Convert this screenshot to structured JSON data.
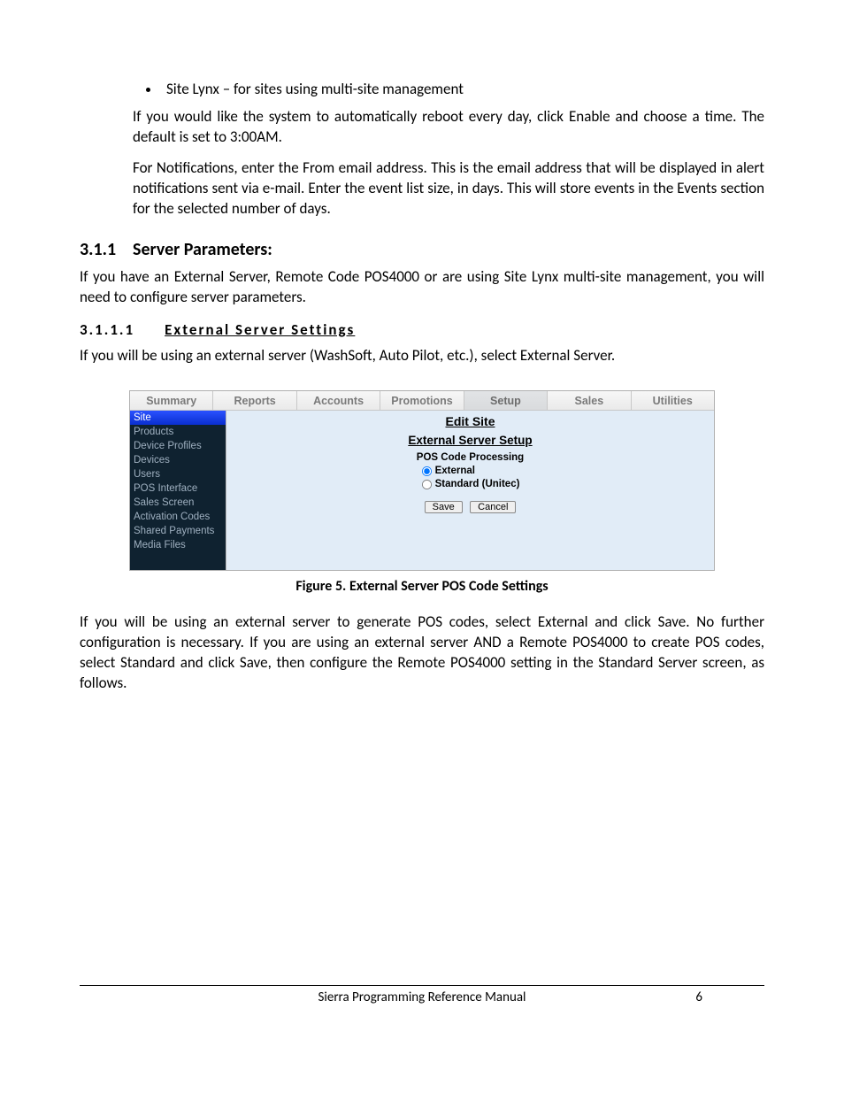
{
  "bullets": [
    "Site Lynx – for sites using multi-site management"
  ],
  "para_reboot": "If you would like the system to automatically reboot every day, click Enable and choose a time. The default is set to 3:00AM.",
  "para_notifications": "For Notifications, enter the From email address. This is the email address that will be displayed in alert notifications sent via e-mail. Enter the event list size, in days. This will store events in the Events section for the selected number of days.",
  "section": {
    "num": "3.1.1",
    "title": "Server Parameters:"
  },
  "para_server": "If you have an External Server, Remote Code POS4000 or are using Site Lynx multi-site management, you will need to configure server parameters.",
  "subsection": {
    "num": "3.1.1.1",
    "title": "External Server Settings"
  },
  "para_external": "If you will be using an external server (WashSoft, Auto Pilot, etc.), select External Server.",
  "ui": {
    "tabs": [
      "Summary",
      "Reports",
      "Accounts",
      "Promotions",
      "Setup",
      "Sales",
      "Utilities"
    ],
    "active_tab_index": 4,
    "sidebar": [
      "Site",
      "Products",
      "Device Profiles",
      "Devices",
      "Users",
      "POS Interface",
      "Sales Screen",
      "Activation Codes",
      "Shared Payments",
      "Media Files"
    ],
    "active_side_index": 0,
    "title1": "Edit Site",
    "title2": "External Server Setup",
    "group_label": "POS Code Processing",
    "radios": [
      {
        "label": "External",
        "checked": true
      },
      {
        "label": "Standard (Unitec)",
        "checked": false
      }
    ],
    "save": "Save",
    "cancel": "Cancel"
  },
  "figure_caption": "Figure 5. External Server POS Code Settings",
  "para_after": "If you will be using an external server to generate POS codes, select External and click Save. No further configuration is necessary. If you are using an external server AND a Remote POS4000 to create POS codes, select Standard and click Save, then configure the Remote POS4000 setting in the Standard Server screen, as follows.",
  "footer": {
    "title": "Sierra Programming Reference Manual",
    "page": "6"
  }
}
